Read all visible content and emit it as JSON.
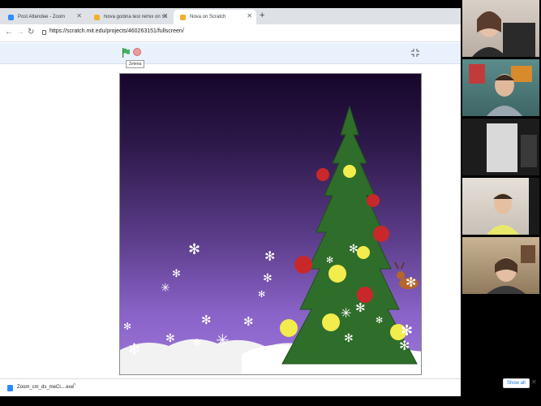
{
  "browser": {
    "tabs": [
      {
        "title": "Post Attendee - Zoom",
        "favicon_color": "#2d8cff",
        "active": false
      },
      {
        "title": "Nova godina test remix on Scra...",
        "favicon_color": "#f0b12f",
        "active": false
      },
      {
        "title": "Nova on Scratch",
        "favicon_color": "#f0b12f",
        "active": true
      }
    ],
    "new_tab_label": "+",
    "url": "https://scratch.mit.edu/projects/460263151/fullscreen/"
  },
  "scratch": {
    "tooltip": "Zelena",
    "flag_color": "#45b060",
    "stop_color": "#ec9c9c"
  },
  "downloads": {
    "file_name": "Zoom_cm_ds_meCi....exe",
    "show_all_label": "Show all"
  },
  "zoom": {
    "participants": [
      "participant-1",
      "participant-2",
      "participant-3",
      "participant-4",
      "participant-5"
    ]
  },
  "colors": {
    "tree": "#2f6e2a",
    "ornament_red": "#c8282a",
    "ornament_yellow": "#f3ec4d",
    "snow": "#ffffff"
  }
}
